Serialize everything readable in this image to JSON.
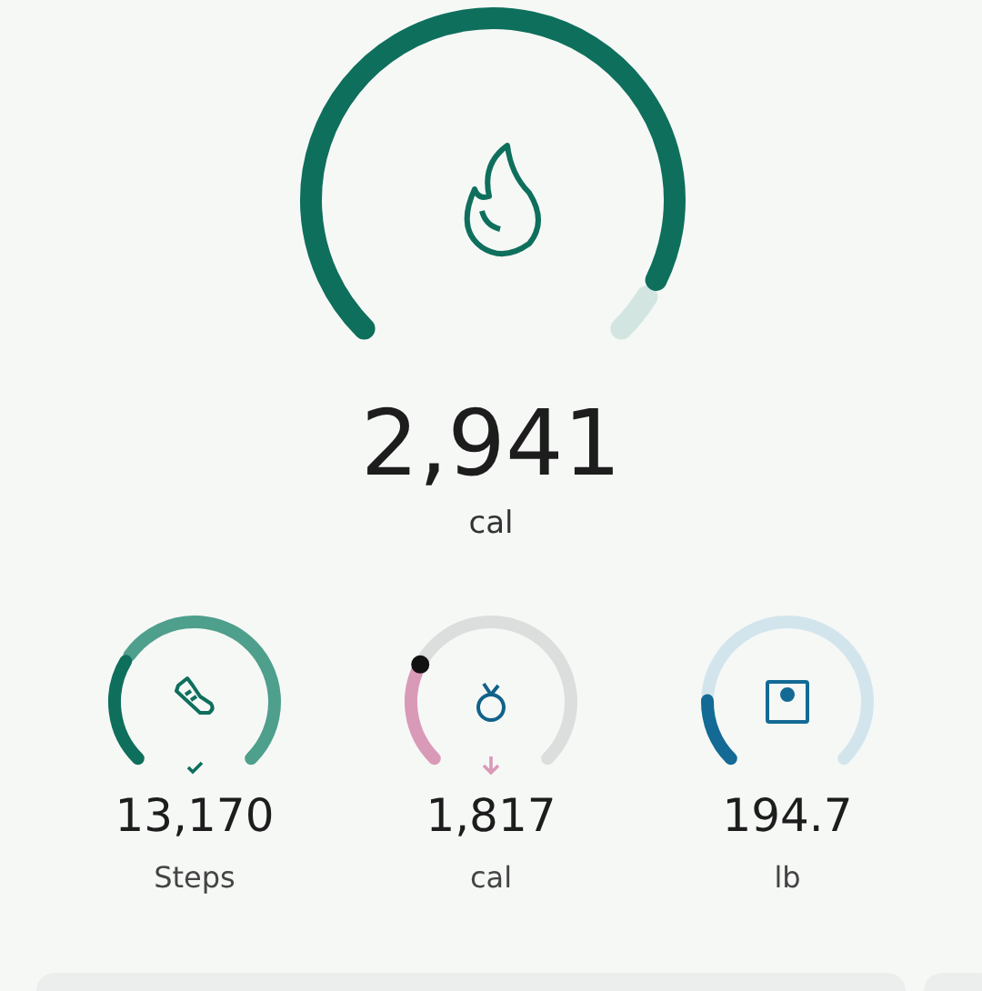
{
  "main": {
    "value": "2,941",
    "unit": "cal"
  },
  "metrics": [
    {
      "kind": "steps",
      "value": "13,170",
      "unit": "Steps",
      "goal_reached": true
    },
    {
      "kind": "food",
      "value": "1,817",
      "unit": "cal",
      "below_target": true
    },
    {
      "kind": "weight",
      "value": "194.7",
      "unit": "lb"
    }
  ]
}
